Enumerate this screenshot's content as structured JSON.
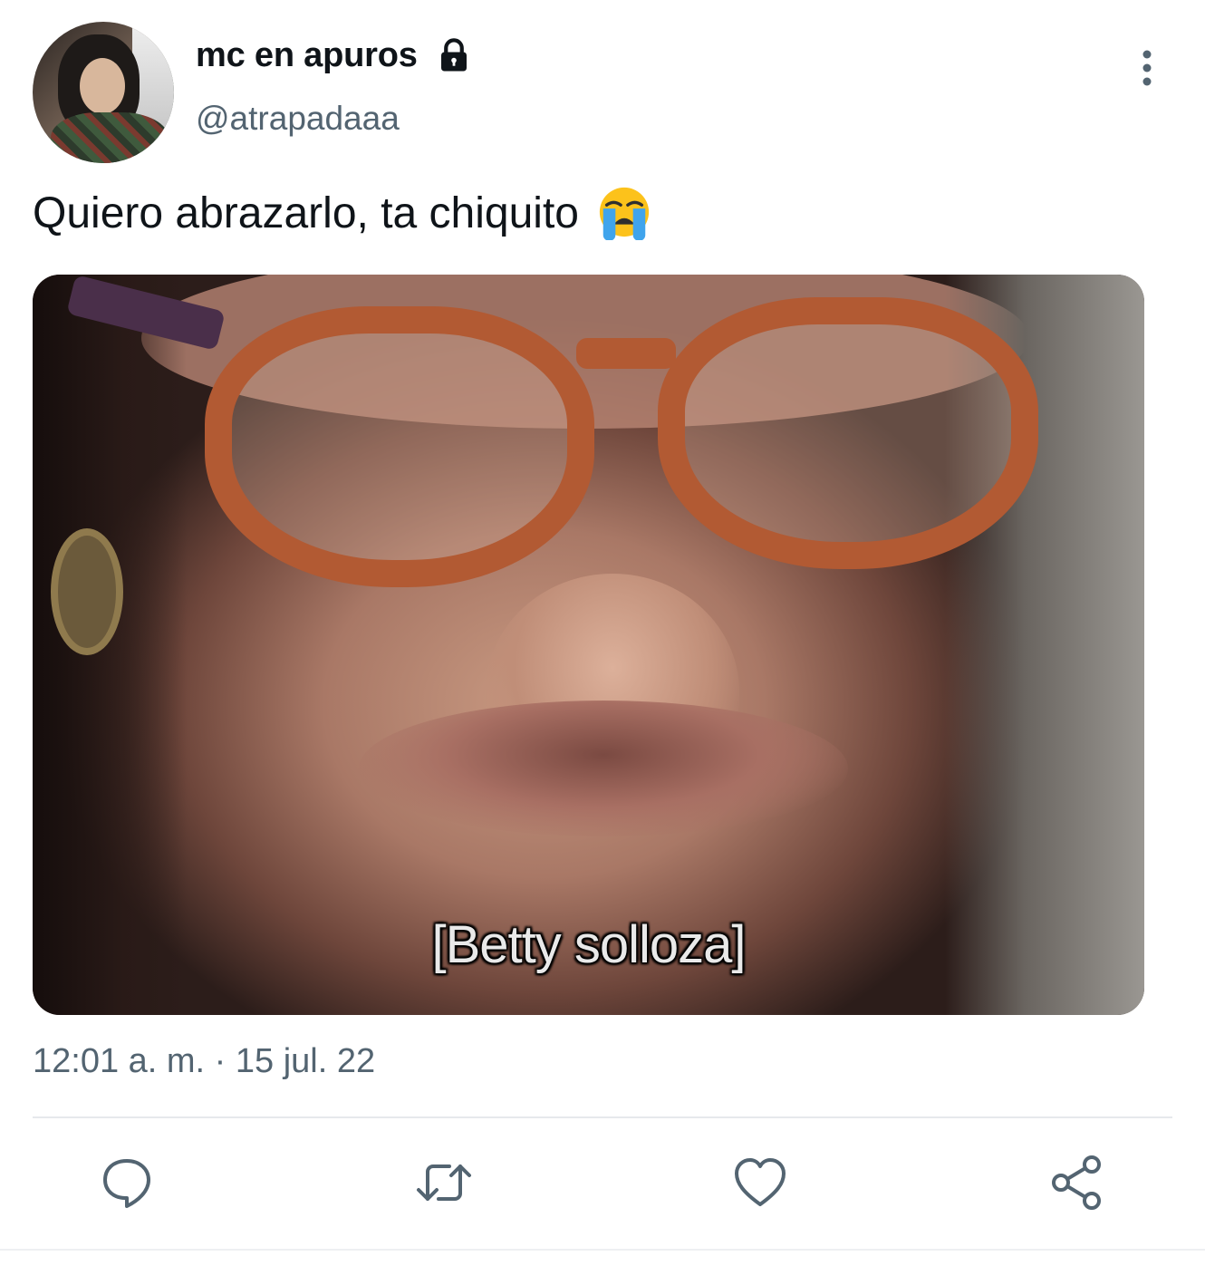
{
  "author": {
    "display_name": "mc en apuros",
    "handle": "@atrapadaaa",
    "protected": true,
    "avatar_icon": "avatar"
  },
  "tweet": {
    "text": "Quiero abrazarlo, ta chiquito",
    "emoji": "loudly-crying-face",
    "media": {
      "caption": "[Betty solloza]"
    },
    "timestamp": "12:01 a. m. · 15 jul. 22"
  },
  "actions": [
    {
      "icon": "reply-icon"
    },
    {
      "icon": "retweet-icon"
    },
    {
      "icon": "like-icon"
    },
    {
      "icon": "share-icon"
    }
  ],
  "colors": {
    "text_primary": "#0f1419",
    "text_secondary": "#536471",
    "icon": "#536471",
    "divider": "#e6e9ec"
  }
}
